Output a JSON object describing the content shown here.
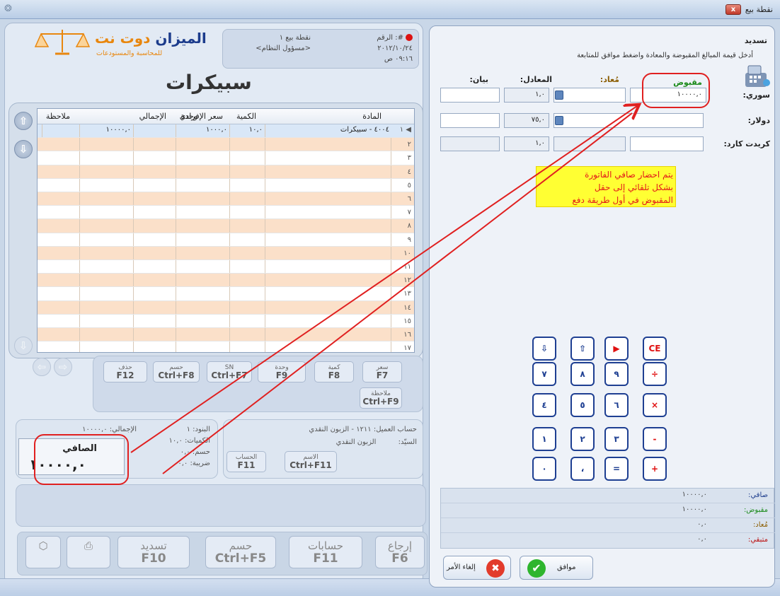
{
  "window": {
    "title": "نقطة بيع",
    "close_label": "x",
    "app_icon": "app-icon"
  },
  "logo": {
    "name_part1": "الميزان",
    "name_part2": "دوت نت",
    "subtitle": "للمحاسبة والمستودعات"
  },
  "header": {
    "doc_number_label": "#: الرقم",
    "pos_label": "نقطة بيع ١",
    "date": "٢٠١٢/١٠/٢٤",
    "user": "<مسؤول النظام>",
    "time": "٠٩:١٦ ص"
  },
  "screen_title": "سبيكرات",
  "grid": {
    "headers": {
      "item": "المادة",
      "qty": "الكمية",
      "price": "سعر الإفرادي",
      "unit": "وحدة",
      "total": "الإجمالي",
      "notes": "ملاحظة"
    },
    "row1": {
      "item": "٤٠٠٤ - سبيكرات",
      "qty": "١٠,٠",
      "price": "١٠٠٠,٠",
      "total": "١٠٠٠٠,٠"
    },
    "row_numbers": [
      "١",
      "٢",
      "٣",
      "٤",
      "٥",
      "٦",
      "٧",
      "٨",
      "٩",
      "١٠",
      "١١",
      "١٢",
      "١٣",
      "١٤",
      "١٥",
      "١٦",
      "١٧"
    ]
  },
  "functions": {
    "price": {
      "label": "سعر",
      "key": "F7"
    },
    "qty": {
      "label": "كمية",
      "key": "F8"
    },
    "unit": {
      "label": "وحدة",
      "key": "F9"
    },
    "sn": {
      "label": "SN",
      "key": "Ctrl+F7"
    },
    "discount": {
      "label": "حسم",
      "key": "Ctrl+F8"
    },
    "delete": {
      "label": "حذف",
      "key": "F12"
    },
    "note": {
      "label": "ملاحظة",
      "key": "Ctrl+F9"
    }
  },
  "summary": {
    "total_label": "الإجمالي:",
    "total_value": "١٠٠٠٠,٠",
    "items_label": "البنود:",
    "items_value": "١",
    "qty_label": "الكميات:",
    "qty_value": "١٠,٠",
    "discount_label": "حسم:",
    "discount_value": "٠,٠",
    "tax_label": "ضريبة:",
    "tax_value": "٠,٠",
    "net_label": "الصافي",
    "net_value": "١٠٠٠٠,٠"
  },
  "customer": {
    "account_label": "حساب العميل:",
    "account_value": "١٢١١ - الزبون النقدي",
    "sir_label": "السيّد:",
    "sir_value": "الزبون النقدي",
    "account_btn": {
      "label": "الحساب",
      "key": "F11"
    },
    "name_btn": {
      "label": "الاسم",
      "key": "Ctrl+F11"
    }
  },
  "bottom": {
    "return": {
      "label": "إرجاع",
      "key": "F6"
    },
    "accounts": {
      "label": "حسابات",
      "key": "F11"
    },
    "discount": {
      "label": "حسم",
      "key": "Ctrl+F5"
    },
    "pay": {
      "label": "تسديد",
      "key": "F10"
    }
  },
  "payment": {
    "title": "تسديد",
    "instructions": "أدخل قيمة المبالغ المقبوضة والمعادة واضغط موافق للمتابعة",
    "col_received": "مقبوض",
    "col_returned": "مُعاد:",
    "col_equivalent": "المعادل:",
    "col_statement": "بيان:",
    "syrian_label": "سوري:",
    "syrian_received": "١٠٠٠٠,٠",
    "syrian_rate": "١,٠",
    "dollar_label": "دولار:",
    "dollar_rate": "٧٥,٠",
    "card_label": "كريدت كارد:",
    "card_rate": "١,٠",
    "note_line1": "يتم احضار صافي الفاتورة",
    "note_line2": "بشكل تلقائي إلى حقل",
    "note_line3": "المقبوض في أول طريقة دفع",
    "keys": [
      "CE",
      "▶",
      "⇧",
      "⇩",
      "÷",
      "٩",
      "٨",
      "٧",
      "×",
      "٦",
      "٥",
      "٤",
      "-",
      "٣",
      "٢",
      "١",
      "+",
      "=",
      "،",
      "٠"
    ],
    "totals": {
      "net_label": "صافي:",
      "net_value": "١٠٠٠٠,٠",
      "received_label": "مقبوض:",
      "received_value": "١٠٠٠٠,٠",
      "returned_label": "مُعاد:",
      "returned_value": "٠,٠",
      "remaining_label": "متبقي:",
      "remaining_value": "٠,٠"
    },
    "ok_label": "موافق",
    "cancel_label": "إلغاء الأمر"
  },
  "colors": {
    "accent": "#1e3f92",
    "highlight": "#e02020",
    "row_alt": "#fbe0c9",
    "note_bg": "#ffff33"
  }
}
